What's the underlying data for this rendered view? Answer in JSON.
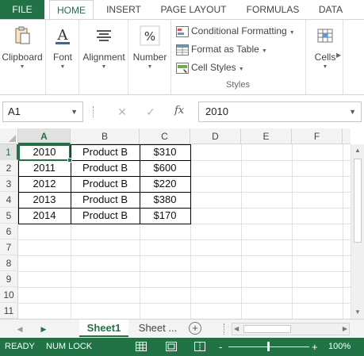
{
  "ribbon": {
    "tabs": [
      "FILE",
      "HOME",
      "INSERT",
      "PAGE LAYOUT",
      "FORMULAS",
      "DATA"
    ],
    "active_tab": "HOME",
    "groups": {
      "clipboard": "Clipboard",
      "font": "Font",
      "alignment": "Alignment",
      "number": "Number",
      "styles": {
        "conditional_formatting": "Conditional Formatting",
        "format_as_table": "Format as Table",
        "cell_styles": "Cell Styles",
        "label": "Styles"
      },
      "cells": "Cells"
    }
  },
  "formula_bar": {
    "name_box": "A1",
    "fx_label": "fx",
    "cancel_glyph": "✕",
    "enter_glyph": "✓",
    "value": "2010"
  },
  "grid": {
    "columns": [
      "A",
      "B",
      "C",
      "D",
      "E",
      "F"
    ],
    "rows": [
      "1",
      "2",
      "3",
      "4",
      "5",
      "6",
      "7",
      "8",
      "9",
      "10",
      "11"
    ],
    "selected_cell": "A1",
    "data": [
      [
        "2010",
        "Product B",
        "$310"
      ],
      [
        "2011",
        "Product B",
        "$600"
      ],
      [
        "2012",
        "Product B",
        "$220"
      ],
      [
        "2013",
        "Product B",
        "$380"
      ],
      [
        "2014",
        "Product B",
        "$170"
      ]
    ]
  },
  "sheets": {
    "tabs": [
      "Sheet1",
      "Sheet ..."
    ],
    "active": "Sheet1",
    "add_glyph": "+"
  },
  "status_bar": {
    "ready": "READY",
    "num_lock": "NUM LOCK",
    "zoom": "100%",
    "zoom_minus": "-",
    "zoom_plus": "+"
  },
  "colors": {
    "accent": "#217346",
    "header_bg": "#f3f3f3",
    "gridline": "#e1e1e1"
  }
}
